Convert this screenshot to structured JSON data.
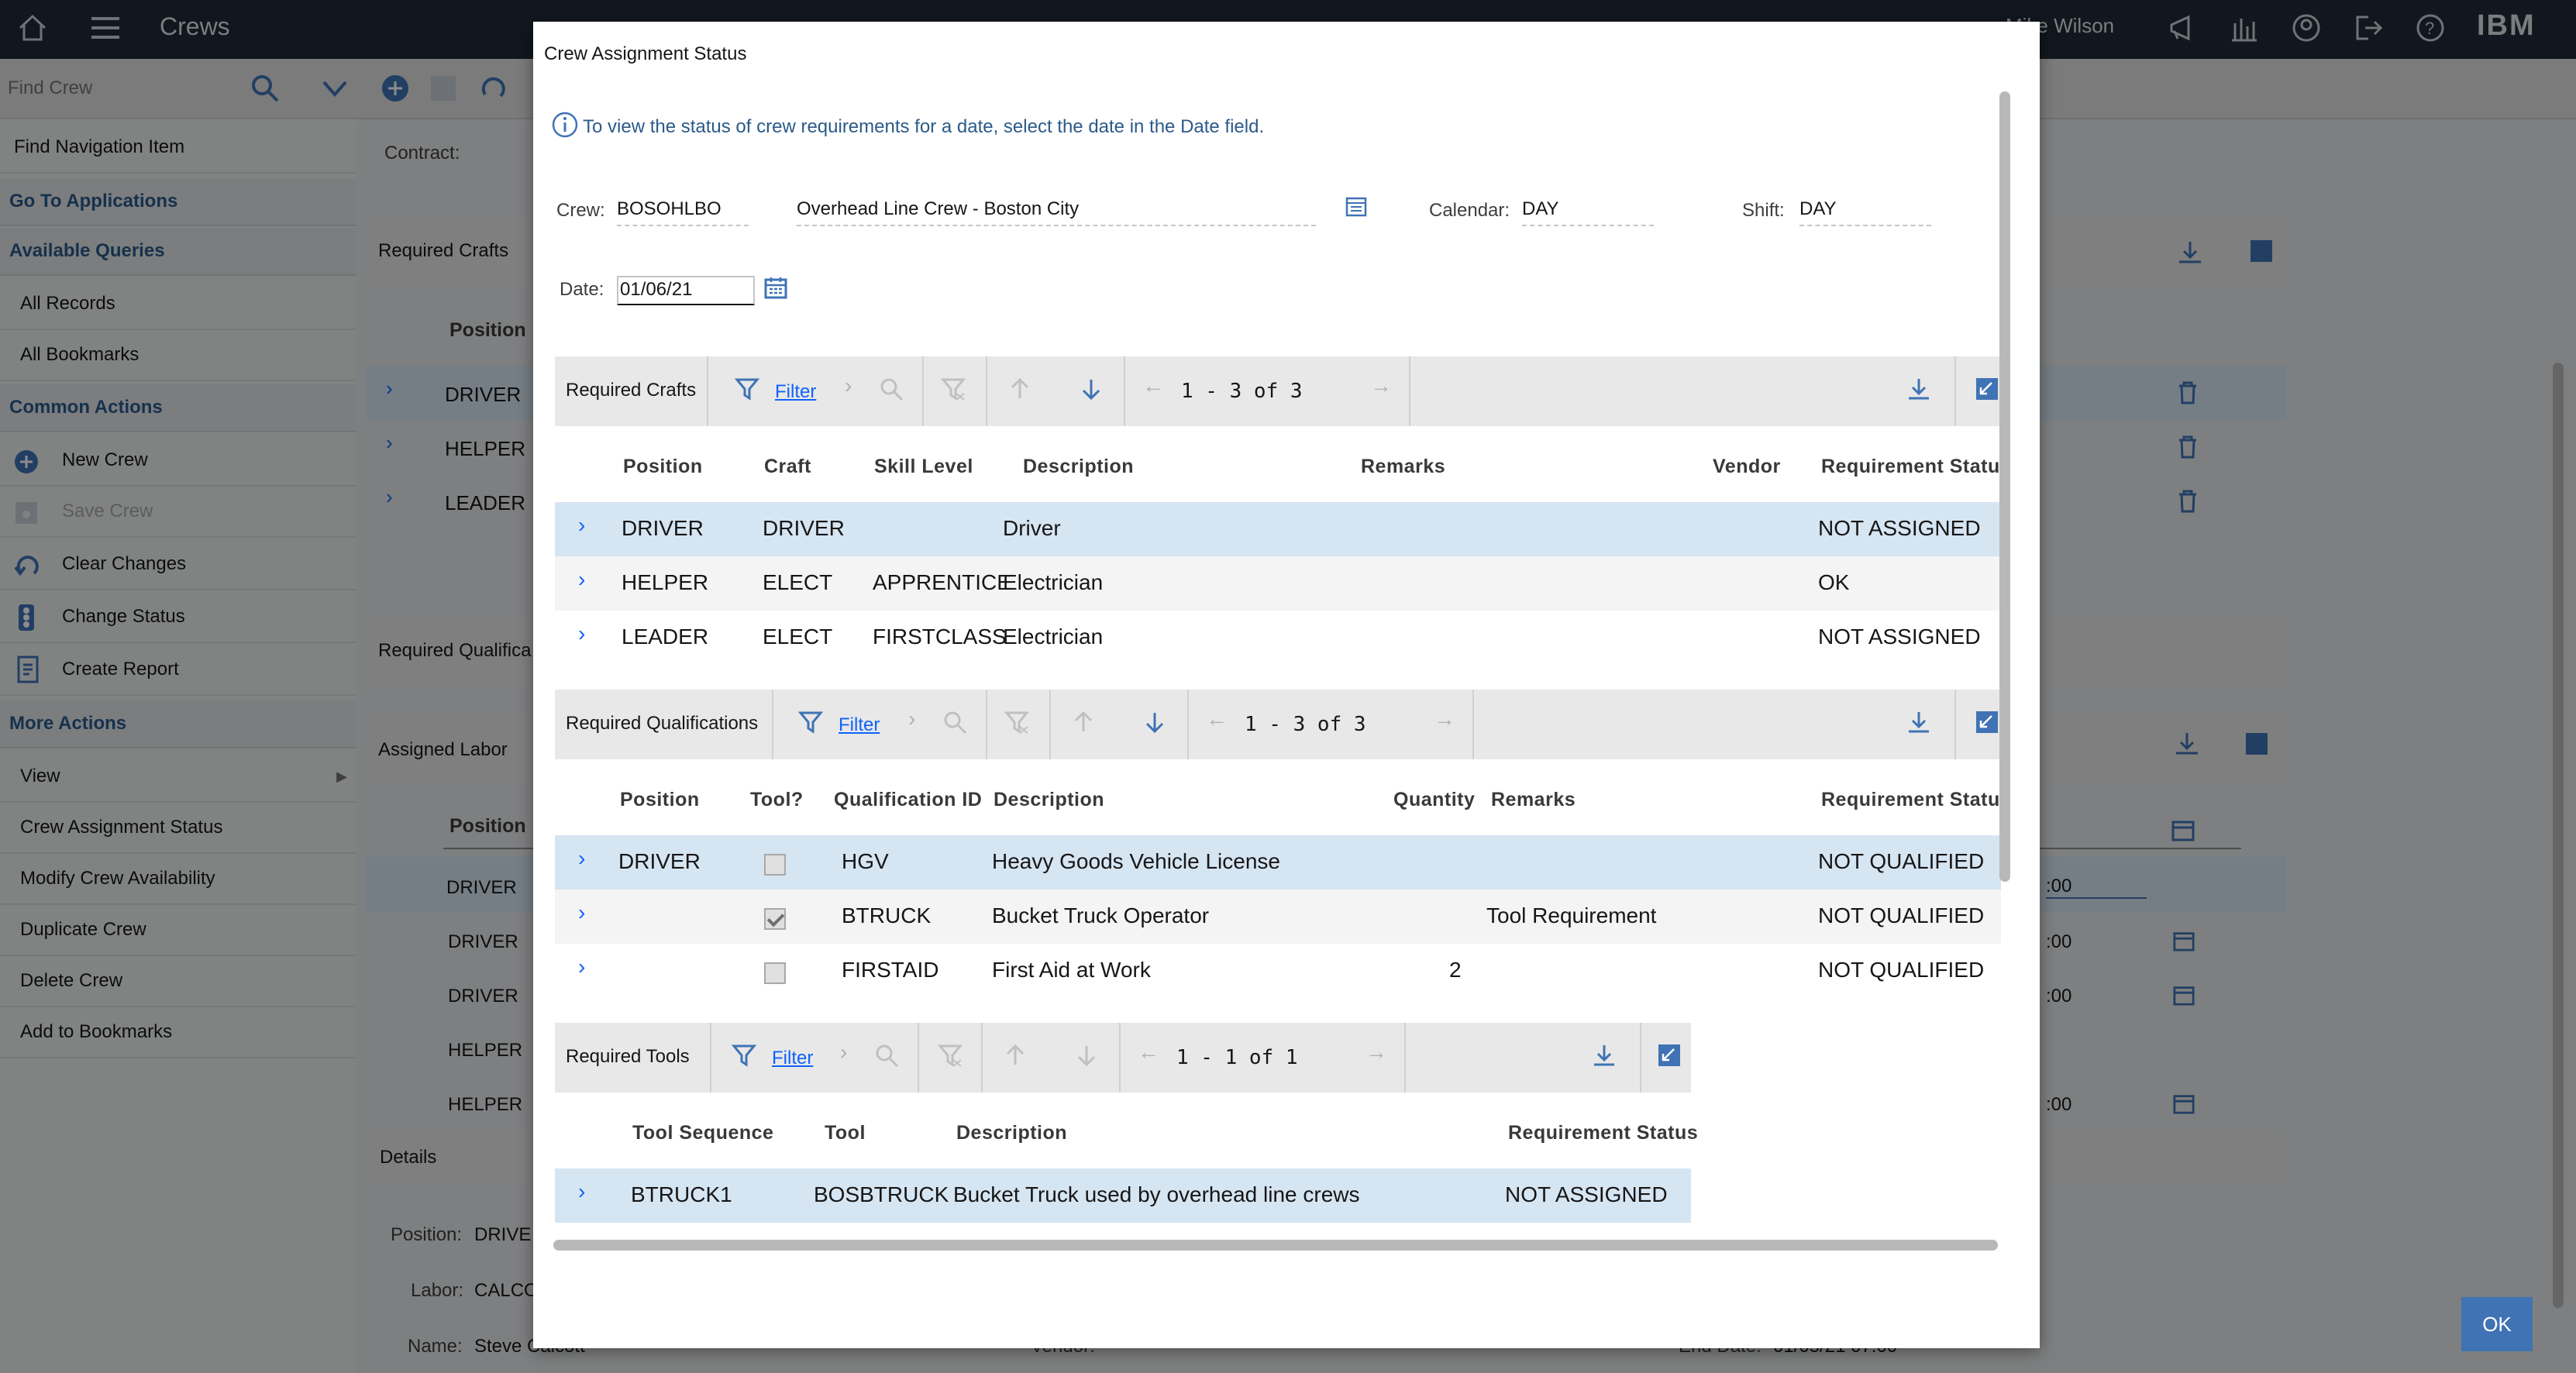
{
  "topbar": {
    "app_title": "Crews",
    "user": "Mike Wilson",
    "brand": "IBM"
  },
  "find_bar": {
    "placeholder": "Find Crew"
  },
  "sidebar": {
    "find_nav": "Find Navigation Item",
    "go_to_apps": "Go To Applications",
    "available_queries": "Available Queries",
    "queries": [
      "All Records",
      "All Bookmarks"
    ],
    "common_actions": "Common Actions",
    "actions": [
      "New Crew",
      "Save Crew",
      "Clear Changes",
      "Change Status",
      "Create Report"
    ],
    "more_actions": "More Actions",
    "more": [
      "View",
      "Crew Assignment Status",
      "Modify Crew Availability",
      "Duplicate Crew",
      "Delete Crew",
      "Add to Bookmarks"
    ]
  },
  "background": {
    "contract_label": "Contract:",
    "required_crafts": "Required Crafts",
    "position_col": "Position",
    "craft_rows": [
      "DRIVER",
      "HELPER",
      "LEADER"
    ],
    "required_qualifications": "Required Qualifica",
    "assigned_labor": "Assigned Labor",
    "labor_position_col": "Position",
    "labor_rows": [
      "DRIVER",
      "DRIVER",
      "DRIVER",
      "HELPER",
      "HELPER"
    ],
    "labor_times": [
      ":00",
      ":00",
      ":00",
      ":00"
    ],
    "labor_selected_time": ":00",
    "details": "Details",
    "position_label": "Position:",
    "position_value": "DRIVE",
    "labor_label": "Labor:",
    "labor_value": "CALCO",
    "name_label": "Name:",
    "name_value": "Steve Calcott",
    "vendor_label": "Vendor:",
    "end_date_label": "End Date:",
    "end_date_value": "01/05/21 07:00"
  },
  "dialog": {
    "title": "Crew Assignment Status",
    "info": "To view the status of crew requirements for a date, select the date in the Date field.",
    "crew_label": "Crew:",
    "crew_value": "BOSOHLBO",
    "crew_desc": "Overhead Line Crew - Boston City",
    "calendar_label": "Calendar:",
    "calendar_value": "DAY",
    "shift_label": "Shift:",
    "shift_value": "DAY",
    "date_label": "Date:",
    "date_value": "01/06/21",
    "ok": "OK",
    "crafts": {
      "title": "Required Crafts",
      "filter": "Filter",
      "pager": "1 - 3 of 3",
      "columns": [
        "Position",
        "Craft",
        "Skill Level",
        "Description",
        "Remarks",
        "Vendor",
        "Requirement Statu"
      ],
      "rows": [
        [
          "DRIVER",
          "DRIVER",
          "",
          "Driver",
          "",
          "",
          "NOT ASSIGNED"
        ],
        [
          "HELPER",
          "ELECT",
          "APPRENTICE",
          "Electrician",
          "",
          "",
          "OK"
        ],
        [
          "LEADER",
          "ELECT",
          "FIRSTCLASS",
          "Electrician",
          "",
          "",
          "NOT ASSIGNED"
        ]
      ]
    },
    "quals": {
      "title": "Required Qualifications",
      "filter": "Filter",
      "pager": "1 - 3 of 3",
      "columns": [
        "Position",
        "Tool?",
        "Qualification ID",
        "Description",
        "Quantity",
        "Remarks",
        "Requirement Statu"
      ],
      "rows": [
        [
          "DRIVER",
          false,
          "HGV",
          "Heavy Goods Vehicle License",
          "",
          "",
          "NOT QUALIFIED"
        ],
        [
          "",
          true,
          "BTRUCK",
          "Bucket Truck Operator",
          "",
          "Tool Requirement",
          "NOT QUALIFIED"
        ],
        [
          "",
          false,
          "FIRSTAID",
          "First Aid at Work",
          "2",
          "",
          "NOT QUALIFIED"
        ]
      ]
    },
    "tools": {
      "title": "Required Tools",
      "filter": "Filter",
      "pager": "1 - 1 of 1",
      "columns": [
        "Tool Sequence",
        "Tool",
        "Description",
        "Requirement Status"
      ],
      "rows": [
        [
          "BTRUCK1",
          "BOSBTRUCK",
          "Bucket Truck used by overhead line crews",
          "NOT ASSIGNED"
        ]
      ]
    }
  }
}
